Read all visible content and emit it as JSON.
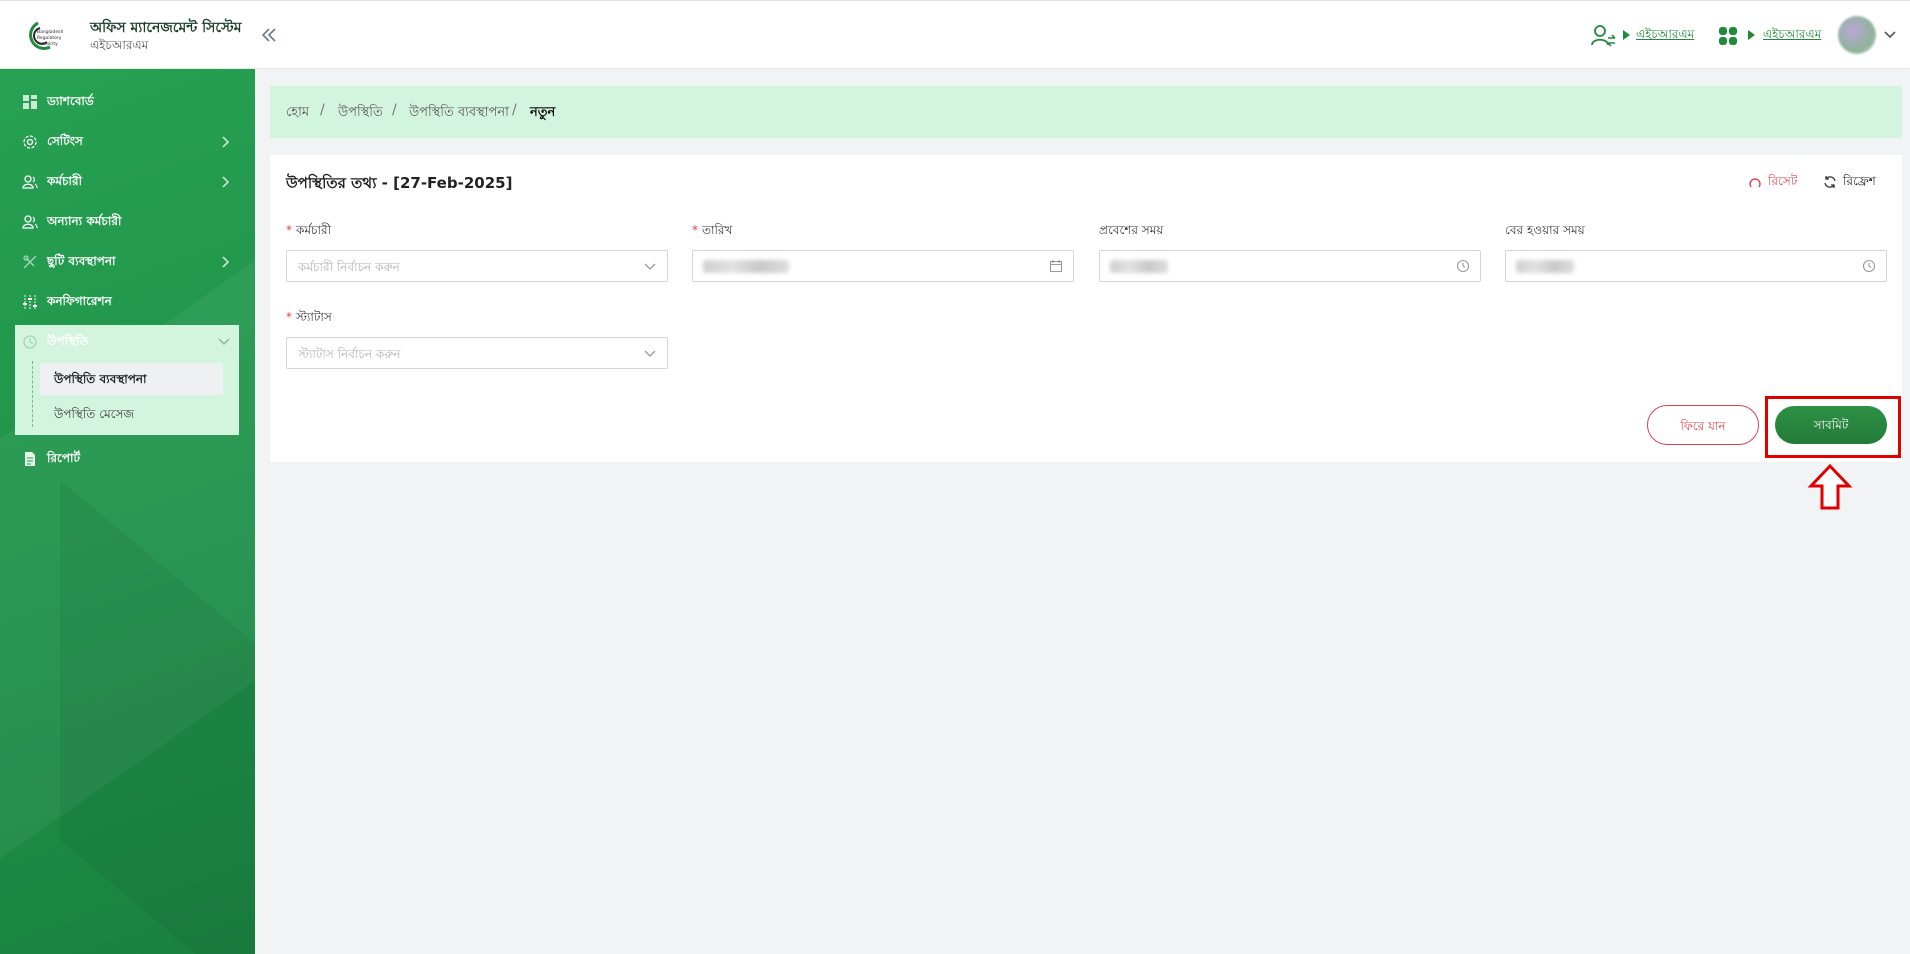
{
  "header": {
    "app_title": "অফিস ম্যানেজমেন্ট সিস্টেম",
    "app_subtitle": "এইচআরএম",
    "logo_text_line1": "Bangladesh",
    "logo_text_line2": "Regulatory",
    "logo_text_line3": "Authority",
    "user_link_label": "এইচআরএম",
    "apps_link_label": "এইচআরএম"
  },
  "sidebar": {
    "items": [
      {
        "label": "ড্যাশবোর্ড",
        "icon": "dashboard-icon"
      },
      {
        "label": "সেটিংস",
        "icon": "gear-icon"
      },
      {
        "label": "কর্মচারী",
        "icon": "users-icon"
      },
      {
        "label": "অন্যান্য কর্মচারী",
        "icon": "users-icon"
      },
      {
        "label": "ছুটি ব্যবস্থাপনা",
        "icon": "leave-icon"
      },
      {
        "label": "কনফিগারেশন",
        "icon": "sliders-icon"
      },
      {
        "label": "উপস্থিতি",
        "icon": "clock-icon"
      },
      {
        "label": "রিপোর্ট",
        "icon": "file-icon"
      }
    ],
    "attendance_sub": {
      "active": "উপস্থিতি ব্যবস্থাপনা",
      "other": "উপস্থিতি মেসেজ"
    }
  },
  "breadcrumb": {
    "home": "হোম",
    "level1": "উপস্থিতি",
    "level2": "উপস্থিতি ব্যবস্থাপনা",
    "current": "নতুন",
    "separator": "/"
  },
  "form": {
    "title": "উপস্থিতির তথ্য - [27-Feb-2025]",
    "reset_label": "রিসেট",
    "refresh_label": "রিফ্রেশ",
    "required_mark": "*",
    "employee_label": "কর্মচারী",
    "employee_placeholder": "কর্মচারী নির্বাচন করুন",
    "date_label": "তারিখ",
    "entry_time_label": "প্রবেশের সময়",
    "exit_time_label": "বের হওয়ার সময়",
    "status_label": "স্ট্যাটাস",
    "status_placeholder": "স্ট্যাটাস নির্বাচন করুন",
    "back_label": "ফিরে যান",
    "submit_label": "সাবমিট"
  },
  "colors": {
    "brand_green": "#1f8a3b",
    "sidebar_green": "#229a4c",
    "light_green": "#d3f5df",
    "danger": "#e0414a",
    "annotation_red": "#e00000"
  }
}
